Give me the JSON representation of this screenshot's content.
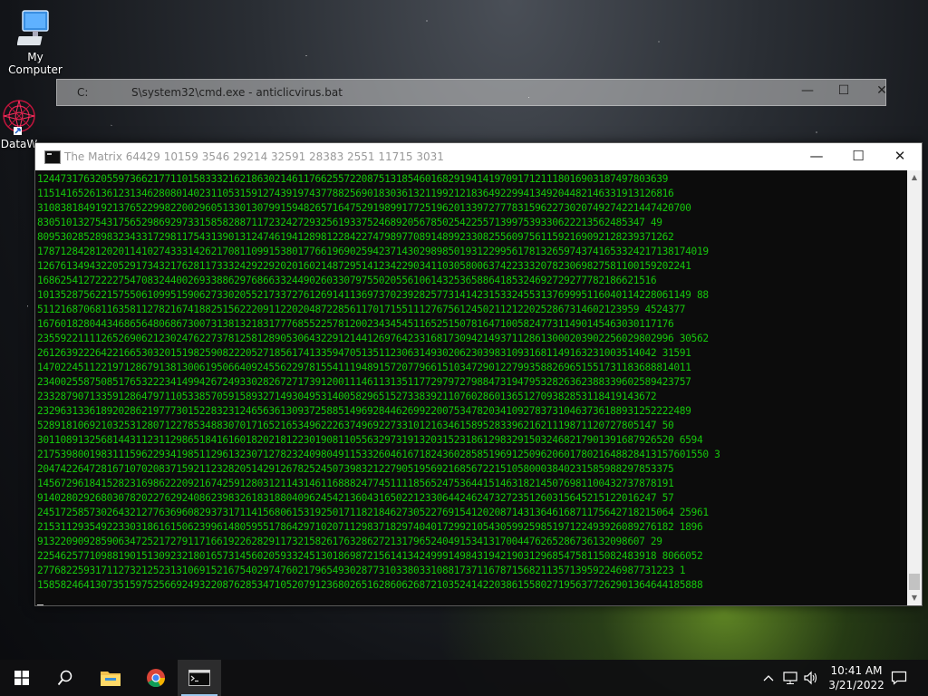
{
  "desktop": {
    "icons": [
      {
        "label": "My Computer",
        "icon": "monitor-icon"
      },
      {
        "label": "DataW",
        "icon": "datawheel-icon"
      }
    ]
  },
  "background_window": {
    "title_prefix": "C:",
    "title_path": "S\\system32\\cmd.exe - anticlicvirus.bat",
    "minimize": "—",
    "maximize": "☐",
    "close": "✕"
  },
  "main_window": {
    "title": "The Matrix  64429 10159 3546 29214 32591 28383 2551 11715 3031",
    "minimize": "—",
    "maximize": "☐",
    "close": "✕",
    "console_color": "#16c60c",
    "console_lines": [
      "1244731763205597366217711015833321621863021461176625572208751318546016829194141970917121118016903187497803639",
      "11514165261361231346280801402311053159127439197437788256901830361321199212183649229941349204482146331913126816",
      "31083818491921376522998220029605133013079915948265716475291989917725196201339727778315962273020749274221447420700",
      "830510132754317565298692973315858288711723242729325619337524689205678502542255713997539330622213562485347 49",
      "80953028528983234331729811754313901312474619412898122842274798977089148992330825560975611592169092128239371262",
      "17871284281202011410274333142621708110991538017766196902594237143029898501931229956178132659743741653324217138174019",
      "12676134943220529173432176281173332429229202016021487295141234229034110305800637422333207823069827581100159202241",
      "16862541272222754708324400269338862976866332449026033079755020556106143253658864185324692729277782186621516",
      "10135287562215755061099515906273302055217337276126914113697370239282577314142315332455313769995116040114228061149 88",
      "51121687068116358112782167418825156222091122020487228561170171551112767561245021121220252867314602123959 4524377",
      "16760182804434686564806867300731381321831777685522578120023434545116525150781647100582477311490145463030117176",
      "23559221111265269062123024762273781258128905306432291214412697642331681730942149371128613000203902256029802996 30562",
      "26126392226422166530320151982590822205271856174133594705135112306314930206230398310931681149163231003514042 31591",
      "14702245112219712867913813006195066409245562297815541119489157207796615103472901227993588269651551731183688814011",
      "23400255875085176532223414994267249330282672717391200111461131351177297972798847319479532826362388339602589423757",
      "23328790713359128647971105338570591589327149304953140058296515273383921107602860136512709382853118419143672",
      "23296313361892028621977730152283231246563613093725885149692844626992200753478203410927837310463736188931252222489",
      "52891810692103253128071227853488307017165216534962226374969227331012163461589528339621621119871120727805147 50",
      "30110891325681443112311298651841616018202181223019081105563297319132031523186129832915032468217901391687926520 6594",
      "21753980019831115962293419851129613230712782324098049115332604616718243602858519691250962060178021648828413157601550 3",
      "20474226472816710702083715921123282051429126782524507398321227905195692168567221510580003840231585988297853375",
      "14567296184152823169862220921674259128031211431461168882477451111856524753644151463182145076981100432737878191",
      "91402802926803078202276292408623983261831880409624542136043165022123306442462473272351260315645215122016247 57",
      "24517258573026432127763696082937317114156806153192501711821846273052276915412020871431364616871175642718215064 25961",
      "21531129354922330318616150623996148059551786429710207112983718297404017299210543059925985197122493926089276182 1896",
      "913220909285906347252172791171661922628291173215826176328627213179652404915341317004476265286736132098607 29",
      "22546257710988190151309232180165731456020593324513018698721561413424999149843194219031296854758115082483918 8066052",
      "27768225931711273212523131069152167540297476021796549302877310338033108817371167871568211357139592246987731223 1",
      "1585824641307351597525669249322087628534710520791236802651628606268721035241422038615580271956377262901364644185888"
    ]
  },
  "taskbar": {
    "items": [
      {
        "name": "start-button",
        "icon": "windows-logo-icon"
      },
      {
        "name": "search-button",
        "icon": "search-icon"
      },
      {
        "name": "file-explorer-button",
        "icon": "folder-icon"
      },
      {
        "name": "chrome-button",
        "icon": "chrome-icon"
      },
      {
        "name": "cmd-button",
        "icon": "terminal-icon"
      }
    ],
    "time": "10:41 AM",
    "date": "3/21/2022",
    "tray_chevron": "^",
    "notification_glyph": "▭"
  }
}
